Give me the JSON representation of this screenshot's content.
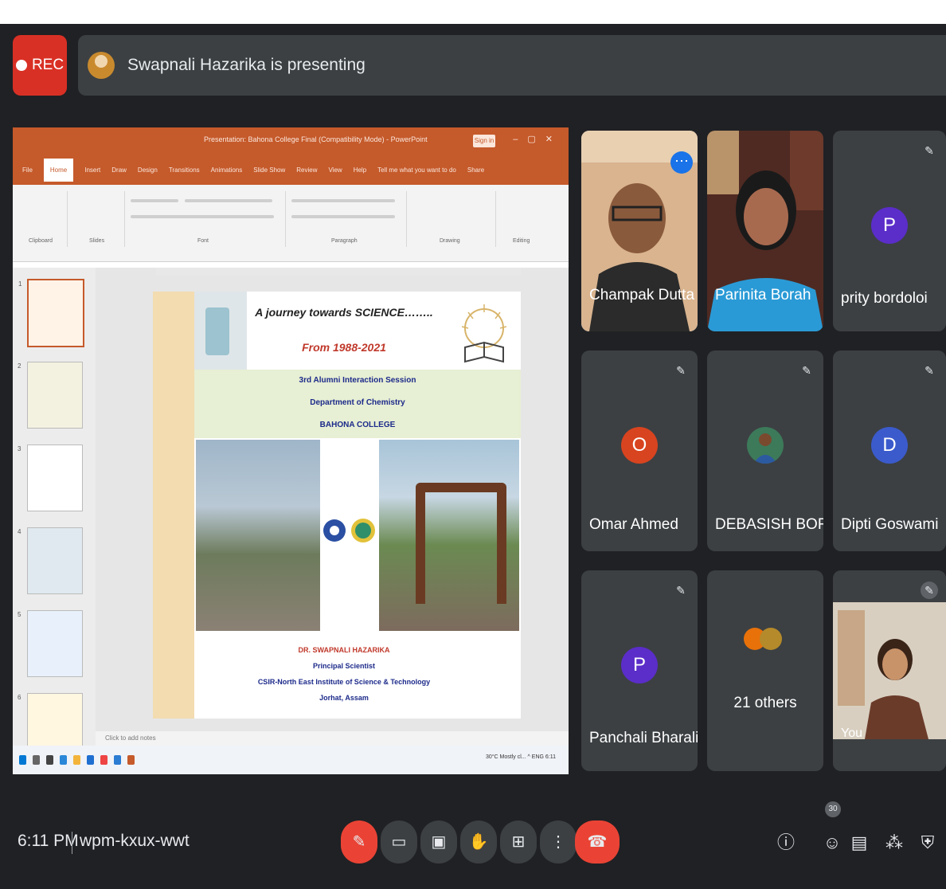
{
  "recording": {
    "label": "REC"
  },
  "presenting": {
    "text": "Swapnali Hazarika is presenting"
  },
  "shared_screen": {
    "window_title": "Presentation: Bahona College Final (Compatibility Mode) - PowerPoint",
    "signin": "Sign in",
    "menu": [
      "File",
      "Home",
      "Insert",
      "Draw",
      "Design",
      "Transitions",
      "Animations",
      "Slide Show",
      "Review",
      "View",
      "Help",
      "Tell me what you want to do",
      "Share"
    ],
    "ribbon_groups": [
      "Clipboard",
      "Slides",
      "Font",
      "Paragraph",
      "Drawing",
      "Editing"
    ],
    "slide": {
      "heading": "A journey towards SCIENCE……..",
      "subheading": "From 1988-2021",
      "session": "3rd Alumni Interaction Session",
      "department": "Department of Chemistry",
      "college": "BAHONA COLLEGE",
      "speaker": "DR. SWAPNALI HAZARIKA",
      "designation": "Principal Scientist",
      "institute": "CSIR-North East Institute of Science & Technology",
      "location": "Jorhat, Assam"
    },
    "thumb_numbers": [
      "1",
      "2",
      "3",
      "4",
      "5",
      "6"
    ],
    "notes_placeholder": "Click to add notes",
    "tray": "30°C Mostly cl... ^ ENG 6:11"
  },
  "participants": [
    {
      "name": "Champak Dutta",
      "type": "video",
      "more_icon": "more-options-icon"
    },
    {
      "name": "Parinita Borah",
      "type": "video"
    },
    {
      "name": "prity bordoloi",
      "initial": "P",
      "color": "#5b2dc9"
    },
    {
      "name": "Omar Ahmed",
      "initial": "O",
      "color": "#d8441f"
    },
    {
      "name": "DEBASISH BORAH",
      "type": "photo"
    },
    {
      "name": "Dipti Goswami",
      "initial": "D",
      "color": "#3b5bcc"
    },
    {
      "name": "Panchali Bharali",
      "initial": "P",
      "color": "#5b2dc9"
    },
    {
      "name": "21 others",
      "type": "group"
    },
    {
      "name": "You",
      "type": "video"
    }
  ],
  "meeting": {
    "time": "6:11 PM",
    "code": "wpm-kxux-wwt",
    "participant_count": "30"
  },
  "icons": {
    "mic": "mic-off-icon",
    "camera": "camera-icon",
    "captions": "captions-icon",
    "hand": "raise-hand-icon",
    "present": "present-icon",
    "more": "more-vert-icon",
    "end": "end-call-icon",
    "info": "info-icon",
    "people": "people-icon",
    "chat": "chat-icon",
    "activities": "activities-icon",
    "host": "host-controls-icon"
  }
}
